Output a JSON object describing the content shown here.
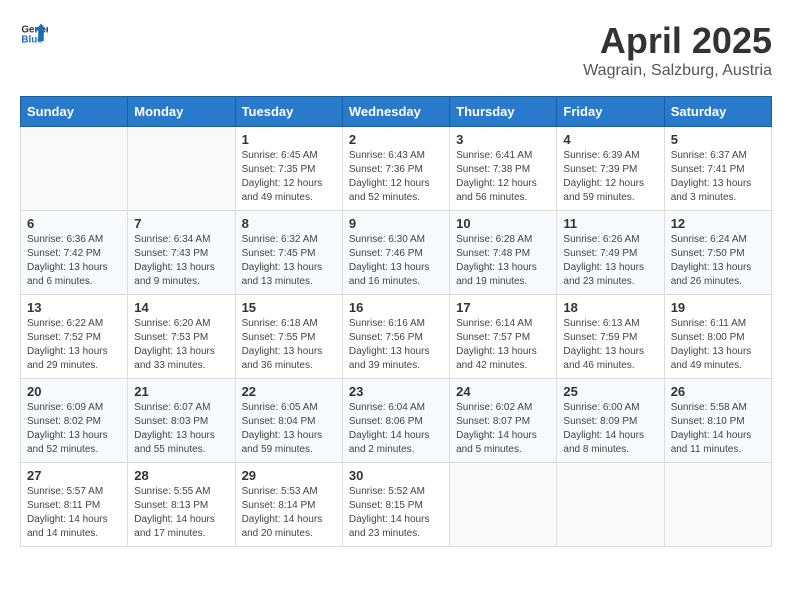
{
  "logo": {
    "text_general": "General",
    "text_blue": "Blue"
  },
  "header": {
    "month_title": "April 2025",
    "location": "Wagrain, Salzburg, Austria"
  },
  "days_of_week": [
    "Sunday",
    "Monday",
    "Tuesday",
    "Wednesday",
    "Thursday",
    "Friday",
    "Saturday"
  ],
  "weeks": [
    [
      {
        "day": "",
        "info": ""
      },
      {
        "day": "",
        "info": ""
      },
      {
        "day": "1",
        "info": "Sunrise: 6:45 AM\nSunset: 7:35 PM\nDaylight: 12 hours and 49 minutes."
      },
      {
        "day": "2",
        "info": "Sunrise: 6:43 AM\nSunset: 7:36 PM\nDaylight: 12 hours and 52 minutes."
      },
      {
        "day": "3",
        "info": "Sunrise: 6:41 AM\nSunset: 7:38 PM\nDaylight: 12 hours and 56 minutes."
      },
      {
        "day": "4",
        "info": "Sunrise: 6:39 AM\nSunset: 7:39 PM\nDaylight: 12 hours and 59 minutes."
      },
      {
        "day": "5",
        "info": "Sunrise: 6:37 AM\nSunset: 7:41 PM\nDaylight: 13 hours and 3 minutes."
      }
    ],
    [
      {
        "day": "6",
        "info": "Sunrise: 6:36 AM\nSunset: 7:42 PM\nDaylight: 13 hours and 6 minutes."
      },
      {
        "day": "7",
        "info": "Sunrise: 6:34 AM\nSunset: 7:43 PM\nDaylight: 13 hours and 9 minutes."
      },
      {
        "day": "8",
        "info": "Sunrise: 6:32 AM\nSunset: 7:45 PM\nDaylight: 13 hours and 13 minutes."
      },
      {
        "day": "9",
        "info": "Sunrise: 6:30 AM\nSunset: 7:46 PM\nDaylight: 13 hours and 16 minutes."
      },
      {
        "day": "10",
        "info": "Sunrise: 6:28 AM\nSunset: 7:48 PM\nDaylight: 13 hours and 19 minutes."
      },
      {
        "day": "11",
        "info": "Sunrise: 6:26 AM\nSunset: 7:49 PM\nDaylight: 13 hours and 23 minutes."
      },
      {
        "day": "12",
        "info": "Sunrise: 6:24 AM\nSunset: 7:50 PM\nDaylight: 13 hours and 26 minutes."
      }
    ],
    [
      {
        "day": "13",
        "info": "Sunrise: 6:22 AM\nSunset: 7:52 PM\nDaylight: 13 hours and 29 minutes."
      },
      {
        "day": "14",
        "info": "Sunrise: 6:20 AM\nSunset: 7:53 PM\nDaylight: 13 hours and 33 minutes."
      },
      {
        "day": "15",
        "info": "Sunrise: 6:18 AM\nSunset: 7:55 PM\nDaylight: 13 hours and 36 minutes."
      },
      {
        "day": "16",
        "info": "Sunrise: 6:16 AM\nSunset: 7:56 PM\nDaylight: 13 hours and 39 minutes."
      },
      {
        "day": "17",
        "info": "Sunrise: 6:14 AM\nSunset: 7:57 PM\nDaylight: 13 hours and 42 minutes."
      },
      {
        "day": "18",
        "info": "Sunrise: 6:13 AM\nSunset: 7:59 PM\nDaylight: 13 hours and 46 minutes."
      },
      {
        "day": "19",
        "info": "Sunrise: 6:11 AM\nSunset: 8:00 PM\nDaylight: 13 hours and 49 minutes."
      }
    ],
    [
      {
        "day": "20",
        "info": "Sunrise: 6:09 AM\nSunset: 8:02 PM\nDaylight: 13 hours and 52 minutes."
      },
      {
        "day": "21",
        "info": "Sunrise: 6:07 AM\nSunset: 8:03 PM\nDaylight: 13 hours and 55 minutes."
      },
      {
        "day": "22",
        "info": "Sunrise: 6:05 AM\nSunset: 8:04 PM\nDaylight: 13 hours and 59 minutes."
      },
      {
        "day": "23",
        "info": "Sunrise: 6:04 AM\nSunset: 8:06 PM\nDaylight: 14 hours and 2 minutes."
      },
      {
        "day": "24",
        "info": "Sunrise: 6:02 AM\nSunset: 8:07 PM\nDaylight: 14 hours and 5 minutes."
      },
      {
        "day": "25",
        "info": "Sunrise: 6:00 AM\nSunset: 8:09 PM\nDaylight: 14 hours and 8 minutes."
      },
      {
        "day": "26",
        "info": "Sunrise: 5:58 AM\nSunset: 8:10 PM\nDaylight: 14 hours and 11 minutes."
      }
    ],
    [
      {
        "day": "27",
        "info": "Sunrise: 5:57 AM\nSunset: 8:11 PM\nDaylight: 14 hours and 14 minutes."
      },
      {
        "day": "28",
        "info": "Sunrise: 5:55 AM\nSunset: 8:13 PM\nDaylight: 14 hours and 17 minutes."
      },
      {
        "day": "29",
        "info": "Sunrise: 5:53 AM\nSunset: 8:14 PM\nDaylight: 14 hours and 20 minutes."
      },
      {
        "day": "30",
        "info": "Sunrise: 5:52 AM\nSunset: 8:15 PM\nDaylight: 14 hours and 23 minutes."
      },
      {
        "day": "",
        "info": ""
      },
      {
        "day": "",
        "info": ""
      },
      {
        "day": "",
        "info": ""
      }
    ]
  ]
}
